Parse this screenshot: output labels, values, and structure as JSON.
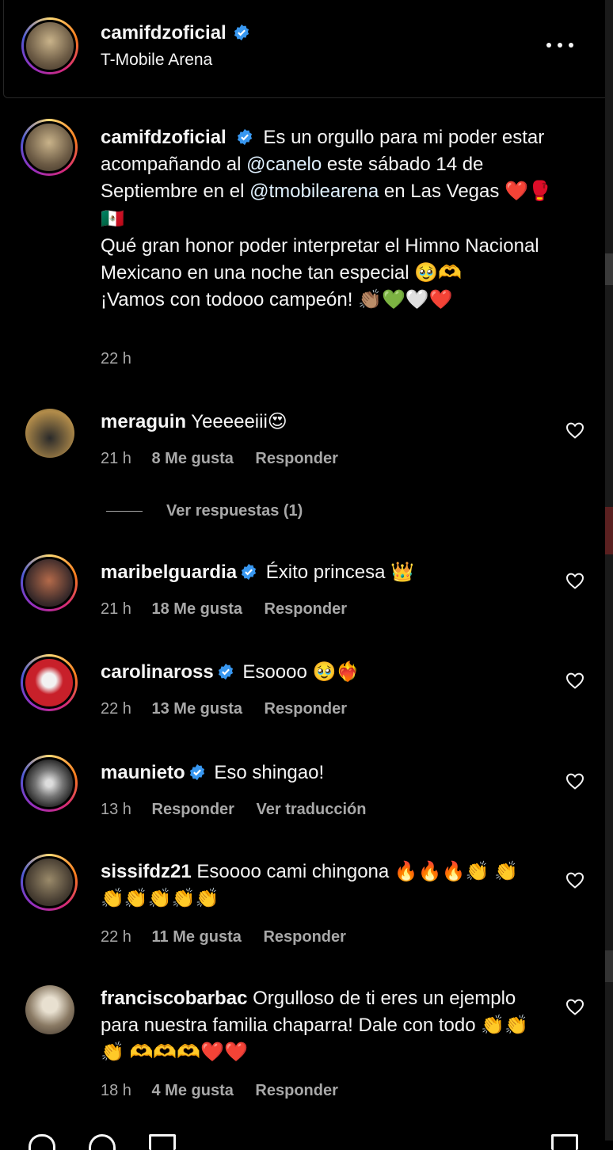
{
  "header": {
    "username": "camifdzoficial",
    "location": "T-Mobile Arena",
    "more_icon": "more-horizontal-icon"
  },
  "caption": {
    "username": "camifdzoficial",
    "part1": "Es un orgullo para mi poder estar acompañando al",
    "mention1": "@canelo",
    "part2": "este sábado 14 de Septiembre en el",
    "mention2": "@tmobilearena",
    "part3": "en Las Vegas ❤️🥊🇲🇽",
    "line2": "Qué gran honor poder interpretar el Himno Nacional Mexicano en una noche tan especial 🥹🫶",
    "line3": "¡Vamos con todooo campeón! 👏🏽💚🤍❤️",
    "time": "22 h"
  },
  "comments": [
    {
      "username": "meraguin",
      "verified": false,
      "text": "Yeeeeeiii😍",
      "time": "21 h",
      "likes": "8 Me gusta",
      "reply": "Responder"
    },
    {
      "username": "maribelguardia",
      "verified": true,
      "text": "Éxito princesa 👑",
      "time": "21 h",
      "likes": "18 Me gusta",
      "reply": "Responder"
    },
    {
      "username": "carolinaross",
      "verified": true,
      "text": "Esoooo 🥹❤️‍🔥",
      "time": "22 h",
      "likes": "13 Me gusta",
      "reply": "Responder"
    },
    {
      "username": "maunieto",
      "verified": true,
      "text": "Eso shingao!",
      "time": "13 h",
      "reply": "Responder",
      "translate": "Ver traducción"
    },
    {
      "username": "sissifdz21",
      "verified": false,
      "text": "Esoooo cami chingona 🔥🔥🔥👏 👏👏👏👏👏👏",
      "time": "22 h",
      "likes": "11 Me gusta",
      "reply": "Responder"
    },
    {
      "username": "franciscobarbac",
      "verified": false,
      "text": "Orgulloso de ti eres un ejemplo para nuestra familia chaparra! Dale con todo 👏👏👏 🫶🫶🫶❤️❤️",
      "time": "18 h",
      "likes": "4 Me gusta",
      "reply": "Responder"
    }
  ],
  "view_replies": "Ver respuestas (1)",
  "icons": {
    "verified": "verified-badge-icon",
    "like": "heart-icon"
  },
  "colors": {
    "background": "#000000",
    "secondary_text": "#a8a8a8",
    "verified_blue": "#3897f0",
    "mention": "#e0f1ff"
  }
}
